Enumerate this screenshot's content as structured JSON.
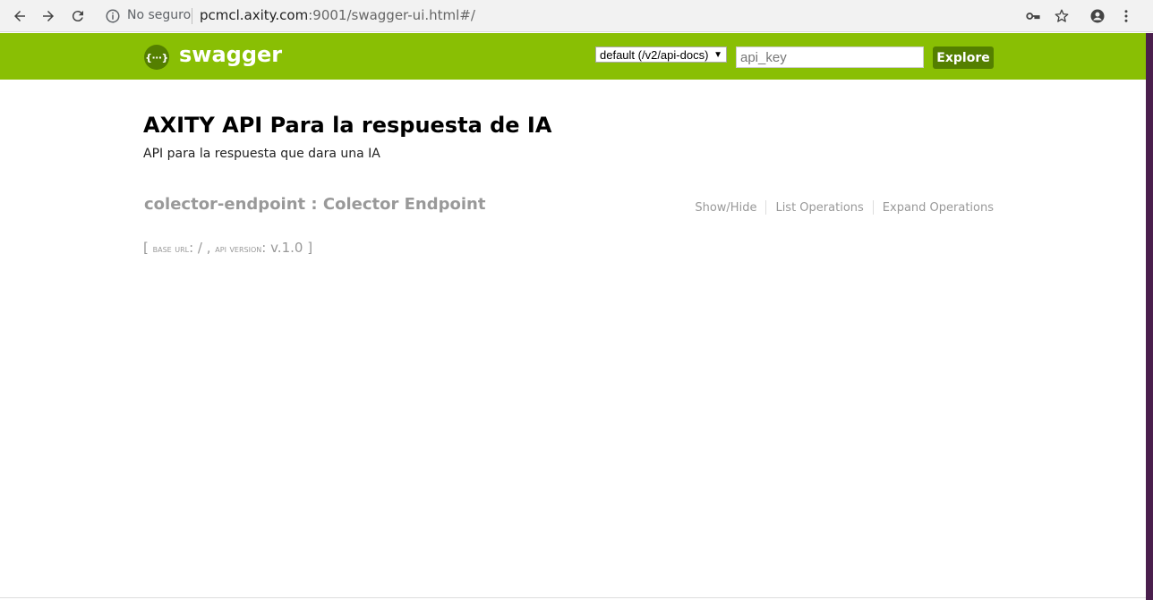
{
  "browser": {
    "security_label": "No seguro",
    "url_host": "pcmcl.axity.com",
    "url_rest": ":9001/swagger-ui.html#/"
  },
  "header": {
    "logo_mark": "{···}",
    "logo_text": "swagger",
    "spec_selected": "default (/v2/api-docs)",
    "api_key_placeholder": "api_key",
    "explore_label": "Explore",
    "brand_color": "#89bf04",
    "button_color": "#547f00"
  },
  "info": {
    "title": "AXITY API Para la respuesta de IA",
    "description": "API para la respuesta que dara una IA"
  },
  "resource": {
    "heading": "colector-endpoint : Colector Endpoint",
    "options": [
      "Show/Hide",
      "List Operations",
      "Expand Operations"
    ]
  },
  "footer": {
    "base_url_label": "base url",
    "base_url_value": "/",
    "api_version_label": "api version",
    "api_version_value": "v.1.0"
  }
}
